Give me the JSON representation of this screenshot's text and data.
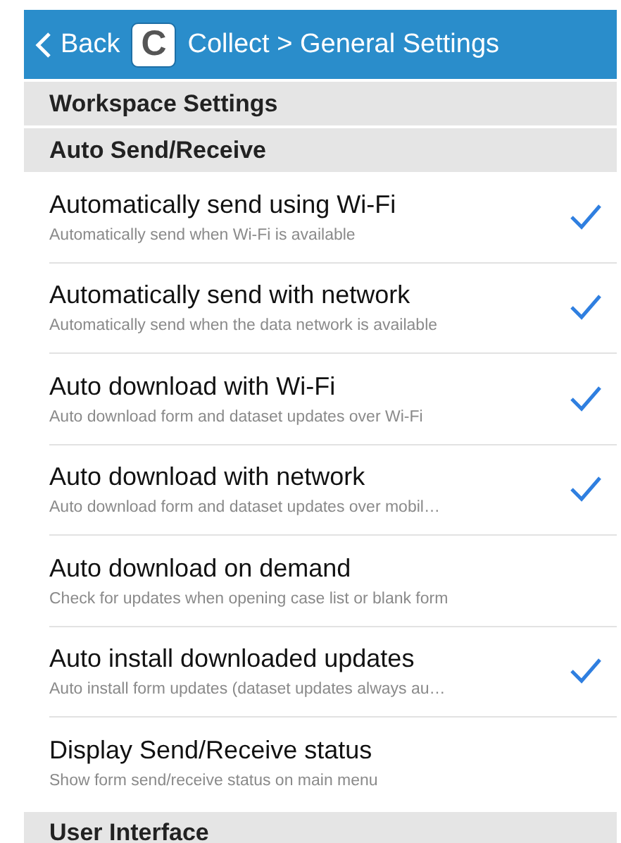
{
  "nav_bar": {
    "back_label": "Back",
    "app_icon_letter": "C",
    "title": "Collect > General Settings"
  },
  "sections": [
    {
      "title": "Workspace Settings"
    },
    {
      "title": "Auto Send/Receive",
      "items": [
        {
          "title": "Automatically send using Wi-Fi",
          "subtitle": "Automatically send when Wi-Fi is available",
          "checked": true
        },
        {
          "title": "Automatically send with network",
          "subtitle": "Automatically send when the data network is available",
          "checked": true
        },
        {
          "title": "Auto download with Wi-Fi",
          "subtitle": "Auto download form and dataset updates over Wi-Fi",
          "checked": true
        },
        {
          "title": "Auto download with network",
          "subtitle": "Auto download form and dataset updates over mobil…",
          "checked": true
        },
        {
          "title": "Auto download on demand",
          "subtitle": "Check for updates when opening case list or blank form",
          "checked": false
        },
        {
          "title": "Auto install downloaded updates",
          "subtitle": "Auto install form updates (dataset updates always au…",
          "checked": true
        },
        {
          "title": "Display Send/Receive status",
          "subtitle": "Show form send/receive status on main menu",
          "checked": false
        }
      ]
    },
    {
      "title": "User Interface"
    }
  ]
}
